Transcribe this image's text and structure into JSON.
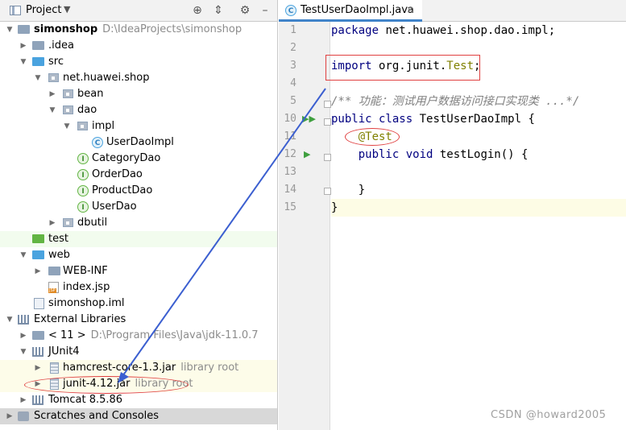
{
  "project_panel": {
    "title": "Project",
    "dropdown_icon": "chevron-down-icon",
    "toolbar_icons": [
      "target-icon",
      "collapse-icon",
      "gear-icon",
      "minimize-icon"
    ]
  },
  "tree": [
    {
      "label": "simonshop",
      "path": "D:\\IdeaProjects\\simonshop",
      "icon": "folder-icon"
    },
    {
      "label": ".idea",
      "icon": "folder-icon"
    },
    {
      "label": "src",
      "icon": "source-folder-icon"
    },
    {
      "label": "net.huawei.shop",
      "icon": "package-icon"
    },
    {
      "label": "bean",
      "icon": "package-icon"
    },
    {
      "label": "dao",
      "icon": "package-icon"
    },
    {
      "label": "impl",
      "icon": "package-icon"
    },
    {
      "label": "UserDaoImpl",
      "icon": "class-icon"
    },
    {
      "label": "CategoryDao",
      "icon": "interface-icon"
    },
    {
      "label": "OrderDao",
      "icon": "interface-icon"
    },
    {
      "label": "ProductDao",
      "icon": "interface-icon"
    },
    {
      "label": "UserDao",
      "icon": "interface-icon"
    },
    {
      "label": "dbutil",
      "icon": "package-icon"
    },
    {
      "label": "test",
      "icon": "test-folder-icon"
    },
    {
      "label": "web",
      "icon": "web-folder-icon"
    },
    {
      "label": "WEB-INF",
      "icon": "folder-icon"
    },
    {
      "label": "index.jsp",
      "icon": "jsp-file-icon"
    },
    {
      "label": "simonshop.iml",
      "icon": "module-file-icon"
    },
    {
      "label": "External Libraries",
      "icon": "libraries-icon"
    },
    {
      "label": "< 11 >",
      "path": "D:\\Program Files\\Java\\jdk-11.0.7",
      "icon": "folder-icon"
    },
    {
      "label": "JUnit4",
      "icon": "libraries-icon"
    },
    {
      "label": "hamcrest-core-1.3.jar",
      "path": "library root",
      "icon": "jar-icon"
    },
    {
      "label": "junit-4.12.jar",
      "path": "library root",
      "icon": "jar-icon"
    },
    {
      "label": "Tomcat 8.5.86",
      "icon": "libraries-icon"
    },
    {
      "label": "Scratches and Consoles",
      "icon": "scratches-icon"
    }
  ],
  "editor": {
    "tab": {
      "label": "TestUserDaoImpl.java",
      "close": "×"
    },
    "lines": [
      {
        "n": "1",
        "text": "package net.huawei.shop.dao.impl;"
      },
      {
        "n": "2",
        "text": ""
      },
      {
        "n": "3",
        "text": "import org.junit.Test;"
      },
      {
        "n": "4",
        "text": ""
      },
      {
        "n": "5",
        "text": "/** 功能：测试用户数据访问接口实现类 ...*/"
      },
      {
        "n": "10",
        "text": "public class TestUserDaoImpl {"
      },
      {
        "n": "11",
        "text": "    @Test"
      },
      {
        "n": "12",
        "text": "    public void testLogin() {"
      },
      {
        "n": "13",
        "text": ""
      },
      {
        "n": "14",
        "text": "    }"
      },
      {
        "n": "15",
        "text": "}"
      }
    ],
    "code": {
      "l1_kw": "package",
      "l1_rest": " net.huawei.shop.dao.impl;",
      "l3_kw": "import",
      "l3_mid": " org.junit.",
      "l3_ty": "Test",
      "l3_end": ";",
      "l5": "/** 功能：测试用户数据访问接口实现类 ...*/",
      "l10_kw": "public class",
      "l10_rest": " TestUserDaoImpl {",
      "l11_ann": "@Test",
      "l12_kw": "public void",
      "l12_rest": " testLogin() {",
      "l14": "}",
      "l15": "}"
    }
  },
  "watermark": "CSDN @howard2005",
  "colors": {
    "annotation": "#e04040",
    "arrow": "#3b5fd0",
    "keyword": "#000080"
  }
}
